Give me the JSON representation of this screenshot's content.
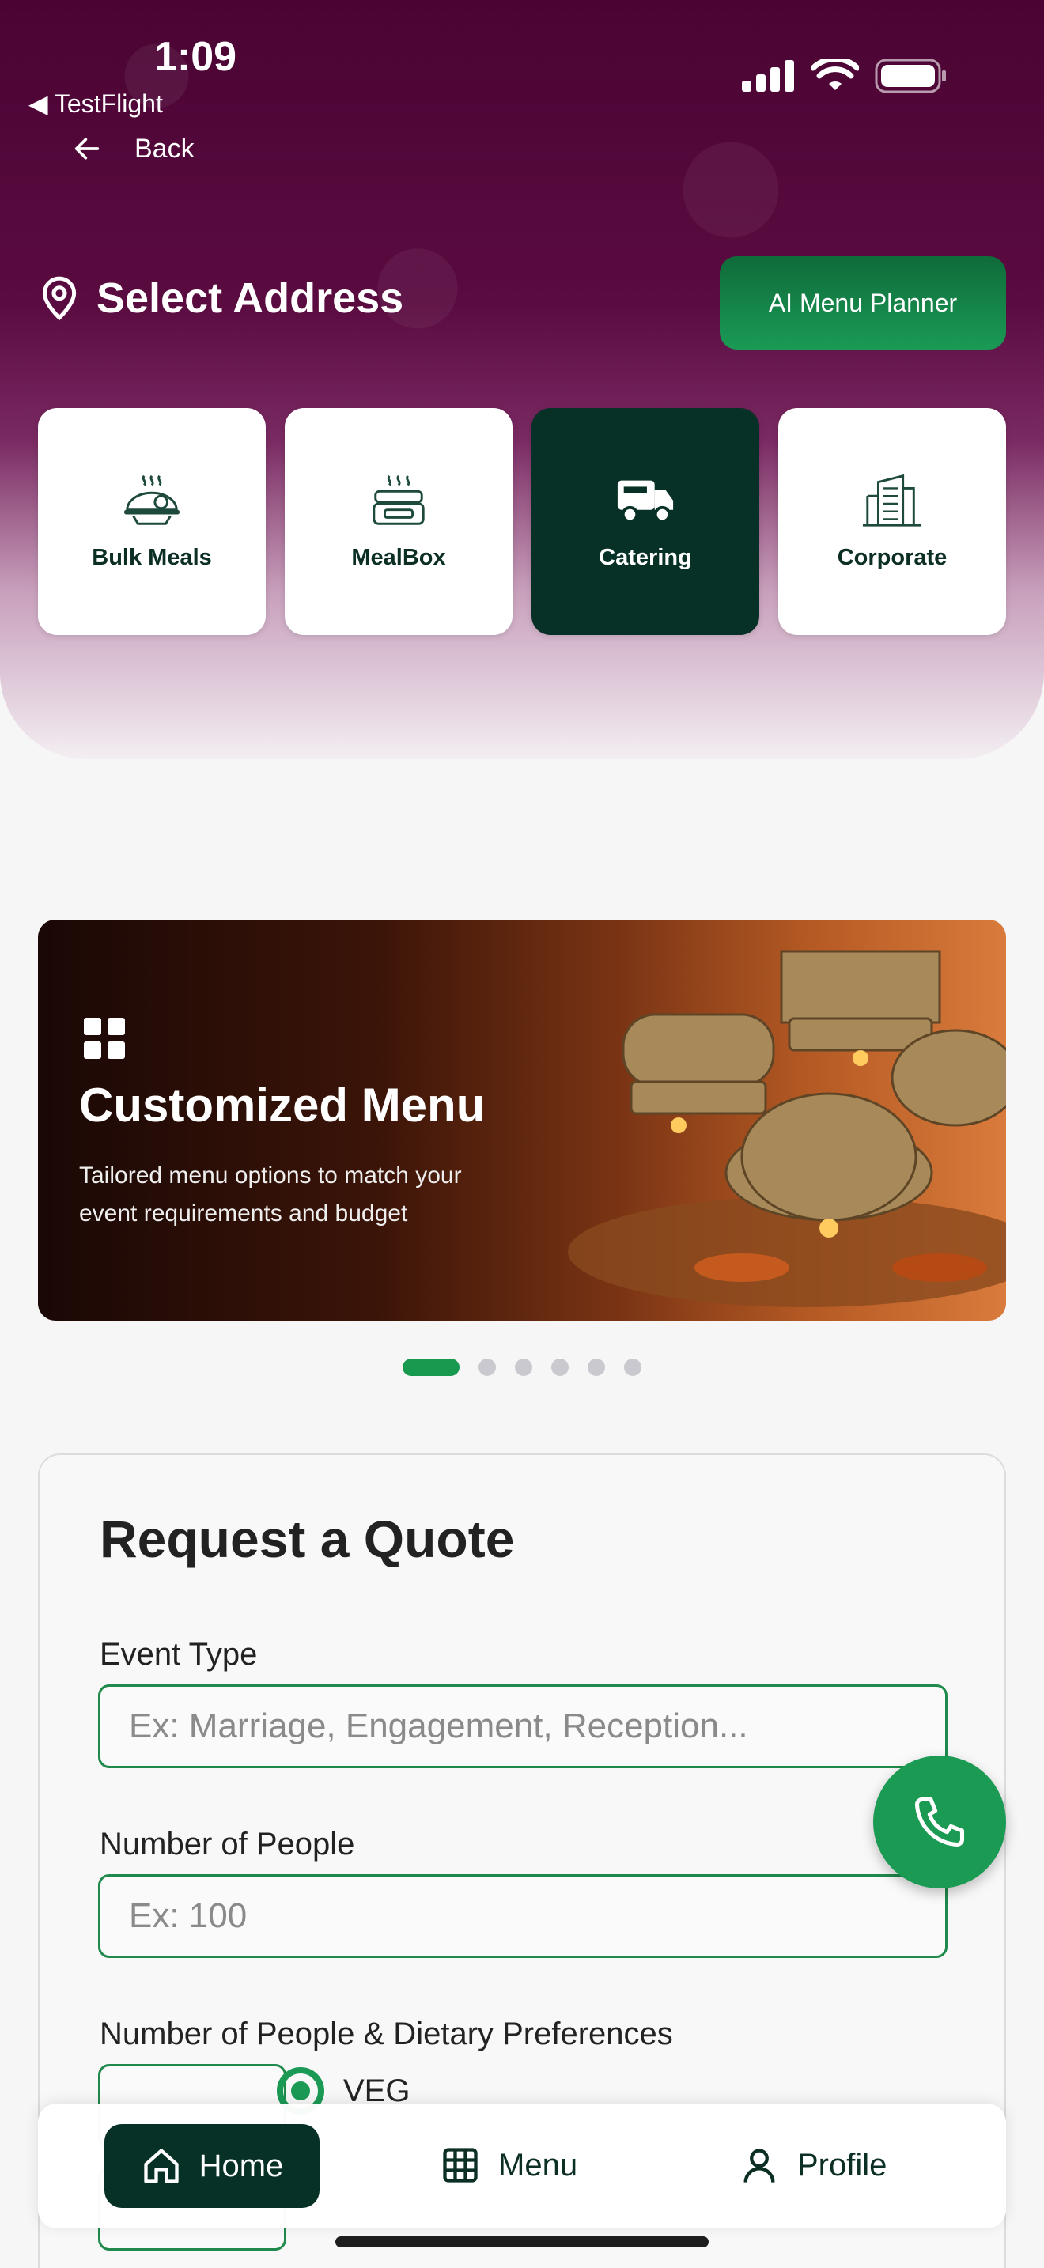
{
  "status_bar": {
    "time": "1:09",
    "back_app": "TestFlight"
  },
  "header": {
    "back_label": "Back",
    "address_label": "Select Address",
    "ai_button_label": "AI Menu Planner"
  },
  "categories": [
    {
      "label": "Bulk Meals",
      "icon": "bulk-meals-icon",
      "active": false
    },
    {
      "label": "MealBox",
      "icon": "mealbox-icon",
      "active": false
    },
    {
      "label": "Catering",
      "icon": "catering-truck-icon",
      "active": true
    },
    {
      "label": "Corporate",
      "icon": "corporate-building-icon",
      "active": false
    }
  ],
  "banner": {
    "title": "Customized Menu",
    "subtitle": "Tailored menu options to match your event requirements and budget",
    "slide_count": 6,
    "active_slide": 0
  },
  "form": {
    "title": "Request a Quote",
    "event_type_label": "Event Type",
    "event_type_placeholder": "Ex: Marriage, Engagement, Reception...",
    "people_label": "Number of People",
    "people_placeholder": "Ex: 100",
    "dietary_label": "Number of People & Dietary Preferences",
    "veg_label": "VEG"
  },
  "bottom_nav": {
    "home": "Home",
    "menu": "Menu",
    "profile": "Profile"
  },
  "colors": {
    "accent_green": "#1a9a55",
    "dark_green": "#073126",
    "header_purple": "#4a0433"
  }
}
